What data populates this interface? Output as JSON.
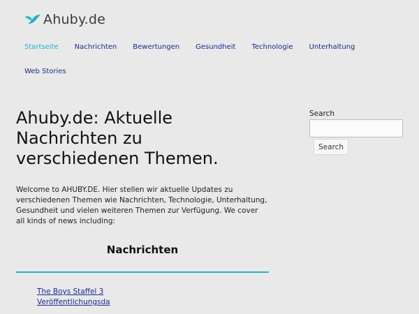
{
  "header": {
    "logo_text": "Ahuby.de",
    "logo_icon": "bird-logo-icon",
    "brand_color": "#1fb5c6"
  },
  "nav": {
    "rows": [
      [
        {
          "label": "Startseite",
          "active": true
        },
        {
          "label": "Nachrichten",
          "active": false
        },
        {
          "label": "Bewertungen",
          "active": false
        },
        {
          "label": "Gesundheit",
          "active": false
        },
        {
          "label": "Technologie",
          "active": false
        },
        {
          "label": "Unterhaltung",
          "active": false
        }
      ],
      [
        {
          "label": "Web Stories",
          "active": false
        }
      ]
    ],
    "link_color": "#1a2b8c",
    "active_color": "#1fb5c6"
  },
  "main": {
    "title": "Ahuby.de: Aktuelle Nachrichten zu verschiedenen Themen.",
    "intro": "Welcome to AHUBY.DE. Hier stellen wir aktuelle Updates zu verschiedenen Themen wie Nachrichten, Technologie, Unterhaltung, Gesundheit und vielen weiteren Themen zur Verfügung. We cover all kinds of news including:",
    "section_heading": "Nachrichten",
    "articles": [
      "The Boys Staffel 3",
      "Veröffentlichungsda"
    ]
  },
  "sidebar": {
    "search_label": "Search",
    "search_value": "",
    "search_button": "Search"
  }
}
